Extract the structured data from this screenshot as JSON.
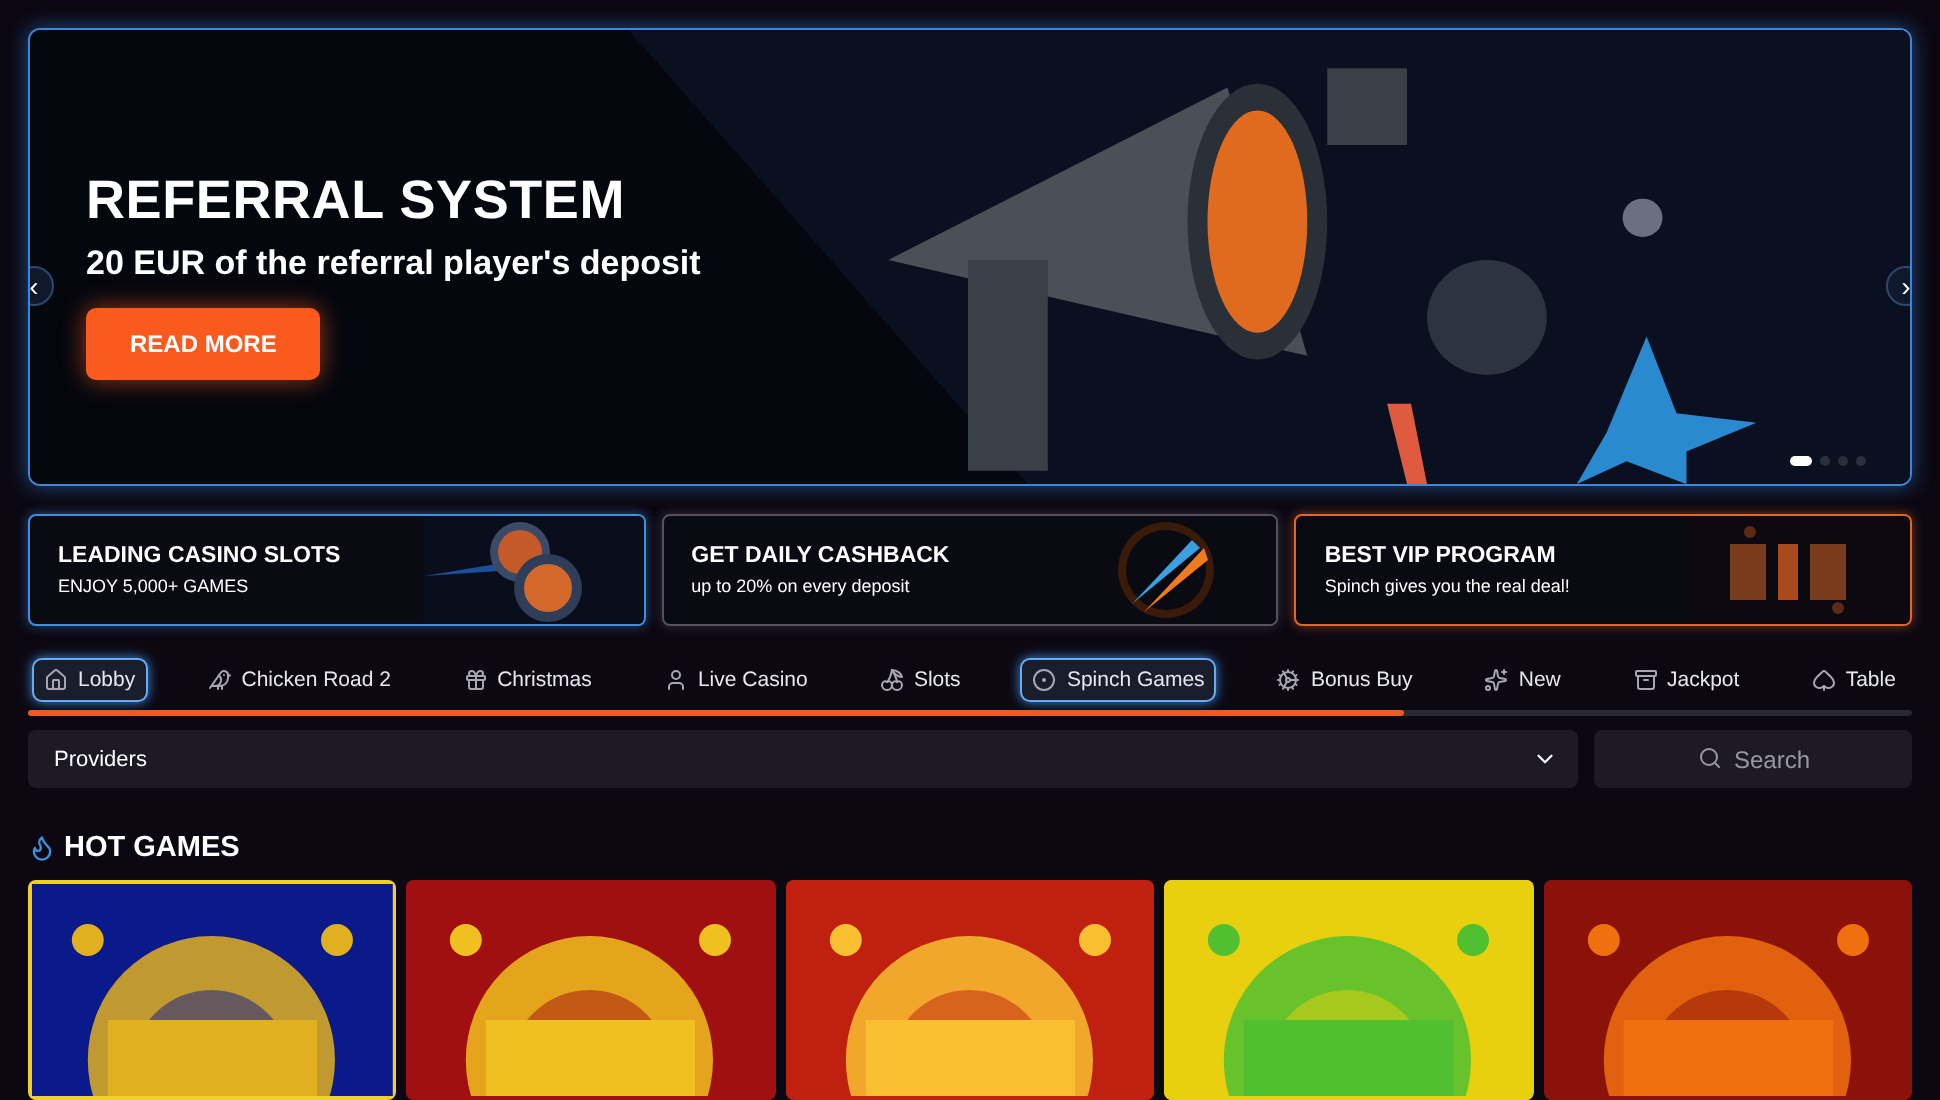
{
  "hero": {
    "title": "REFERRAL SYSTEM",
    "subtitle": "20 EUR of the referral player's deposit",
    "button": "READ MORE",
    "prev": "‹",
    "next": "›",
    "pages": [
      {
        "selected": true
      },
      {
        "selected": false
      },
      {
        "selected": false
      },
      {
        "selected": false
      }
    ]
  },
  "promos": [
    {
      "title": "LEADING CASINO SLOTS",
      "text": "ENJOY 5,000+ GAMES",
      "color": "#3d8fe0",
      "kind": "coins"
    },
    {
      "title": "GET DAILY CASHBACK",
      "text": "up to 20% on every deposit",
      "color": "#55525e",
      "kind": "arrows"
    },
    {
      "title": "BEST VIP PROGRAM",
      "text": "Spinch gives you the real deal!",
      "color": "#e0662a",
      "kind": "vip"
    }
  ],
  "tabs": [
    {
      "label": "Lobby",
      "selected": true
    },
    {
      "label": "Chicken Road 2",
      "selected": false
    },
    {
      "label": "Christmas",
      "selected": false
    },
    {
      "label": "Live Casino",
      "selected": false
    },
    {
      "label": "Slots",
      "selected": false
    },
    {
      "label": "Spinch Games",
      "selected": true
    },
    {
      "label": "Bonus Buy",
      "selected": false
    },
    {
      "label": "New",
      "selected": false
    },
    {
      "label": "Jackpot",
      "selected": false
    },
    {
      "label": "Table",
      "selected": false
    }
  ],
  "scroll": {
    "level": 0.73
  },
  "filters": {
    "providers": "Providers",
    "search": {
      "placeholder": "Search"
    }
  },
  "section": {
    "title": "HOT GAMES"
  },
  "games": [
    {
      "kind": "coin"
    },
    {
      "kind": "stars"
    },
    {
      "kind": "sun"
    },
    {
      "kind": "frog"
    },
    {
      "kind": "fire"
    }
  ]
}
